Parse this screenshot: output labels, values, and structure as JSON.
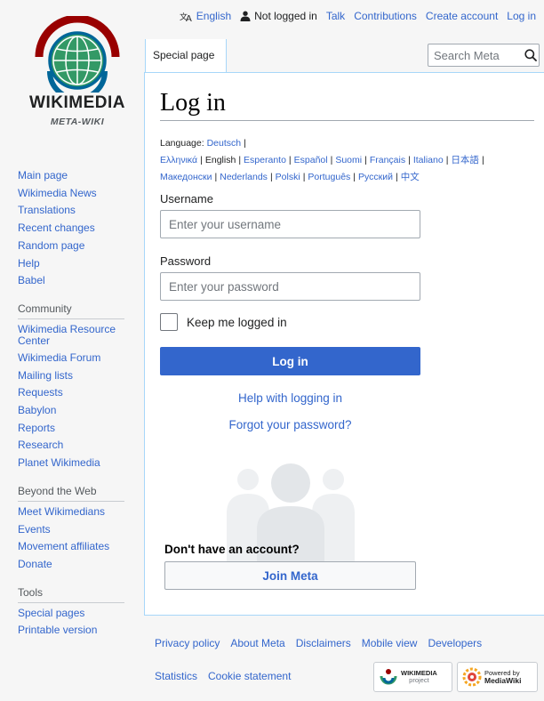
{
  "personal": {
    "language": "English",
    "not_logged_in": "Not logged in",
    "talk": "Talk",
    "contributions": "Contributions",
    "create_account": "Create account",
    "log_in": "Log in"
  },
  "logo": {
    "wordmark": "WIKIMEDIA",
    "tagline": "META-WIKI"
  },
  "sidebar": {
    "nav": [
      "Main page",
      "Wikimedia News",
      "Translations",
      "Recent changes",
      "Random page",
      "Help",
      "Babel"
    ],
    "community_heading": "Community",
    "community": [
      "Wikimedia Resource Center",
      "Wikimedia Forum",
      "Mailing lists",
      "Requests",
      "Babylon",
      "Reports",
      "Research",
      "Planet Wikimedia"
    ],
    "beyond_heading": "Beyond the Web",
    "beyond": [
      "Meet Wikimedians",
      "Events",
      "Movement affiliates",
      "Donate"
    ],
    "tools_heading": "Tools",
    "tools": [
      "Special pages",
      "Printable version"
    ]
  },
  "tabs": {
    "special_page": "Special page"
  },
  "search": {
    "placeholder": "Search Meta"
  },
  "page": {
    "title": "Log in",
    "language_label": "Language:",
    "languages": [
      "Deutsch",
      "Ελληνικά",
      "English",
      "Esperanto",
      "Español",
      "Suomi",
      "Français",
      "Italiano",
      "日本語",
      "Македонски",
      "Nederlands",
      "Polski",
      "Português",
      "Русский",
      "中文"
    ],
    "current_language": "English"
  },
  "form": {
    "username_label": "Username",
    "username_placeholder": "Enter your username",
    "password_label": "Password",
    "password_placeholder": "Enter your password",
    "remember_label": "Keep me logged in",
    "login_button": "Log in",
    "help_link": "Help with logging in",
    "forgot_link": "Forgot your password?",
    "no_account": "Don't have an account?",
    "join_button": "Join Meta"
  },
  "footer": {
    "links_row1": [
      "Privacy policy",
      "About Meta",
      "Disclaimers",
      "Mobile view",
      "Developers"
    ],
    "links_row2": [
      "Statistics",
      "Cookie statement"
    ],
    "badge_wikimedia": [
      "WIKIMEDIA",
      "project"
    ],
    "badge_mediawiki": [
      "Powered by",
      "MediaWiki"
    ]
  },
  "colors": {
    "link": "#3366cc",
    "primary_button": "#3366cc",
    "border": "#a7d7f9"
  }
}
